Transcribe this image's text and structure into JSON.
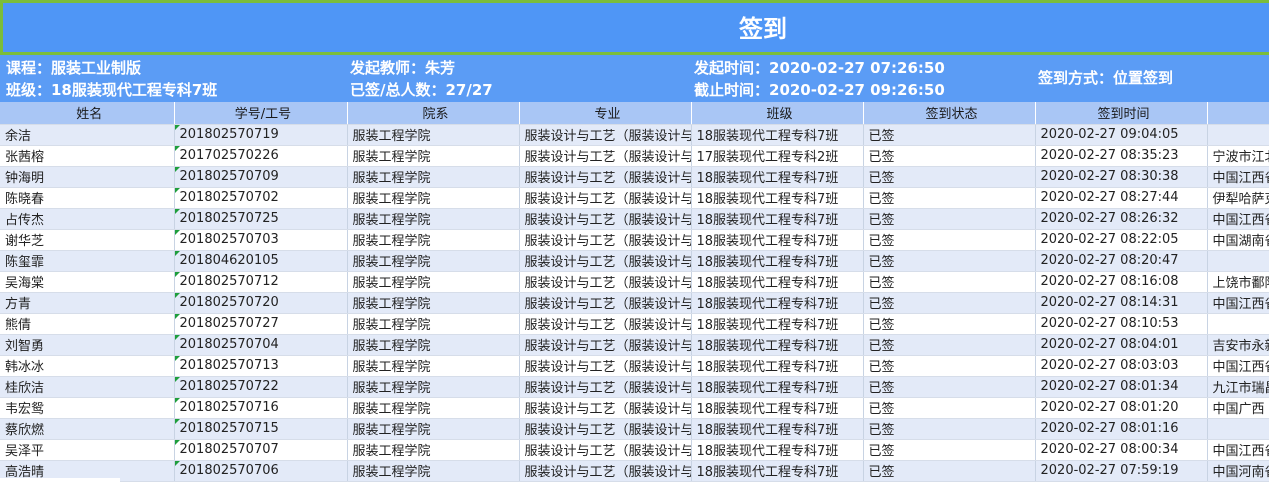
{
  "title": "签到",
  "info": {
    "course": "课程：服装工业制版",
    "class": "班级：18服装现代工程专科7班",
    "teacher": "发起教师：朱芳",
    "signed": "已签/总人数：27/27",
    "start_time": "发起时间：2020-02-27 07:26:50",
    "end_time": "截止时间：2020-02-27 09:26:50",
    "method": "签到方式：位置签到"
  },
  "columns": [
    "姓名",
    "学号/工号",
    "院系",
    "专业",
    "班级",
    "签到状态",
    "签到时间",
    ""
  ],
  "rows": [
    {
      "name": "余洁",
      "id": "201802570719",
      "dept": "服装工程学院",
      "major": "服装设计与工艺（服装设计与",
      "class": "18服装现代工程专科7班",
      "status": "已签",
      "time": "2020-02-27 09:04:05",
      "loc": ""
    },
    {
      "name": "张茜榕",
      "id": "201702570226",
      "dept": "服装工程学院",
      "major": "服装设计与工艺（服装设计与",
      "class": "17服装现代工程专科2班",
      "status": "已签",
      "time": "2020-02-27 08:35:23",
      "loc": "宁波市江北"
    },
    {
      "name": "钟海明",
      "id": "201802570709",
      "dept": "服装工程学院",
      "major": "服装设计与工艺（服装设计与",
      "class": "18服装现代工程专科7班",
      "status": "已签",
      "time": "2020-02-27 08:30:38",
      "loc": "中国江西省"
    },
    {
      "name": "陈晓春",
      "id": "201802570702",
      "dept": "服装工程学院",
      "major": "服装设计与工艺（服装设计与",
      "class": "18服装现代工程专科7班",
      "status": "已签",
      "time": "2020-02-27 08:27:44",
      "loc": "伊犁哈萨克"
    },
    {
      "name": "占传杰",
      "id": "201802570725",
      "dept": "服装工程学院",
      "major": "服装设计与工艺（服装设计与",
      "class": "18服装现代工程专科7班",
      "status": "已签",
      "time": "2020-02-27 08:26:32",
      "loc": "中国江西省"
    },
    {
      "name": "谢华芝",
      "id": "201802570703",
      "dept": "服装工程学院",
      "major": "服装设计与工艺（服装设计与",
      "class": "18服装现代工程专科7班",
      "status": "已签",
      "time": "2020-02-27 08:22:05",
      "loc": "中国湖南省"
    },
    {
      "name": "陈玺霏",
      "id": "201804620105",
      "dept": "服装工程学院",
      "major": "服装设计与工艺（服装设计与",
      "class": "18服装现代工程专科7班",
      "status": "已签",
      "time": "2020-02-27 08:20:47",
      "loc": ""
    },
    {
      "name": "吴海棠",
      "id": "201802570712",
      "dept": "服装工程学院",
      "major": "服装设计与工艺（服装设计与",
      "class": "18服装现代工程专科7班",
      "status": "已签",
      "time": "2020-02-27 08:16:08",
      "loc": "上饶市鄱阳"
    },
    {
      "name": "方青",
      "id": "201802570720",
      "dept": "服装工程学院",
      "major": "服装设计与工艺（服装设计与",
      "class": "18服装现代工程专科7班",
      "status": "已签",
      "time": "2020-02-27 08:14:31",
      "loc": "中国江西省"
    },
    {
      "name": "熊倩",
      "id": "201802570727",
      "dept": "服装工程学院",
      "major": "服装设计与工艺（服装设计与",
      "class": "18服装现代工程专科7班",
      "status": "已签",
      "time": "2020-02-27 08:10:53",
      "loc": ""
    },
    {
      "name": "刘智勇",
      "id": "201802570704",
      "dept": "服装工程学院",
      "major": "服装设计与工艺（服装设计与",
      "class": "18服装现代工程专科7班",
      "status": "已签",
      "time": "2020-02-27 08:04:01",
      "loc": "吉安市永新"
    },
    {
      "name": "韩冰冰",
      "id": "201802570713",
      "dept": "服装工程学院",
      "major": "服装设计与工艺（服装设计与",
      "class": "18服装现代工程专科7班",
      "status": "已签",
      "time": "2020-02-27 08:03:03",
      "loc": "中国江西省"
    },
    {
      "name": "桂欣洁",
      "id": "201802570722",
      "dept": "服装工程学院",
      "major": "服装设计与工艺（服装设计与",
      "class": "18服装现代工程专科7班",
      "status": "已签",
      "time": "2020-02-27 08:01:34",
      "loc": "九江市瑞昌"
    },
    {
      "name": "韦宏鸳",
      "id": "201802570716",
      "dept": "服装工程学院",
      "major": "服装设计与工艺（服装设计与",
      "class": "18服装现代工程专科7班",
      "status": "已签",
      "time": "2020-02-27 08:01:20",
      "loc": "中国广西"
    },
    {
      "name": "蔡欣燃",
      "id": "201802570715",
      "dept": "服装工程学院",
      "major": "服装设计与工艺（服装设计与",
      "class": "18服装现代工程专科7班",
      "status": "已签",
      "time": "2020-02-27 08:01:16",
      "loc": ""
    },
    {
      "name": "吴泽平",
      "id": "201802570707",
      "dept": "服装工程学院",
      "major": "服装设计与工艺（服装设计与",
      "class": "18服装现代工程专科7班",
      "status": "已签",
      "time": "2020-02-27 08:00:34",
      "loc": "中国江西省"
    },
    {
      "name": "高浩晴",
      "id": "201802570706",
      "dept": "服装工程学院",
      "major": "服装设计与工艺（服装设计与",
      "class": "18服装现代工程专科7班",
      "status": "已签",
      "time": "2020-02-27 07:59:19",
      "loc": "中国河南省"
    }
  ]
}
